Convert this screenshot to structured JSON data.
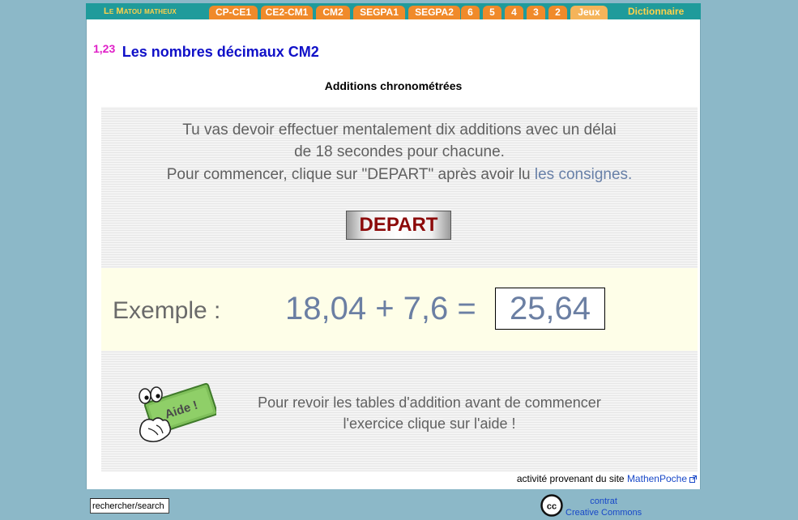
{
  "nav": {
    "brand_first": "L",
    "brand_e": "e",
    "brand_m": "M",
    "brand_rest": "atou matheux",
    "tabs": [
      "CP-CE1",
      "CE2-CM1",
      "CM2",
      "SEGPA1",
      "SEGPA2",
      "6",
      "5",
      "4",
      "3",
      "2",
      "Jeux"
    ],
    "dictionary": "Dictionnaire"
  },
  "page": {
    "number": "1,23",
    "title": "Les nombres décimaux CM2",
    "subtitle": "Additions chronométrées"
  },
  "instructions": {
    "line1": "Tu vas devoir effectuer mentalement dix additions avec un délai",
    "line2": "de 18 secondes pour chacune.",
    "line3_prefix": "Pour commencer, clique sur \"DEPART\" après avoir lu ",
    "line3_link": "les consignes."
  },
  "depart_button": "DEPART",
  "example": {
    "label": "Exemple :",
    "equation": "18,04 + 7,6 =",
    "answer": "25,64"
  },
  "aide": {
    "icon_label": "Aide !",
    "line1": "Pour revoir les tables d'addition avant de commencer",
    "line2": "l'exercice clique sur l'aide !"
  },
  "source": {
    "prefix": "activité provenant du site ",
    "link": "MathenPoche"
  },
  "footer": {
    "search_value": "rechercher/search",
    "cc_line1": "contrat",
    "cc_line2": "Creative Commons"
  },
  "colors": {
    "background": "#8cb8c8",
    "nav_bar": "#1f9b9b",
    "tab": "#f08a2a",
    "brand": "#ffd24a",
    "title": "#1010c8",
    "title_number": "#e020c8",
    "depart_text": "#8c0a0a",
    "example_text": "#6b7fa3",
    "link": "#1848c8"
  },
  "icons": {
    "aide": "aide-sign-hand-icon",
    "external": "external-link-icon",
    "creative_commons": "cc-icon"
  }
}
